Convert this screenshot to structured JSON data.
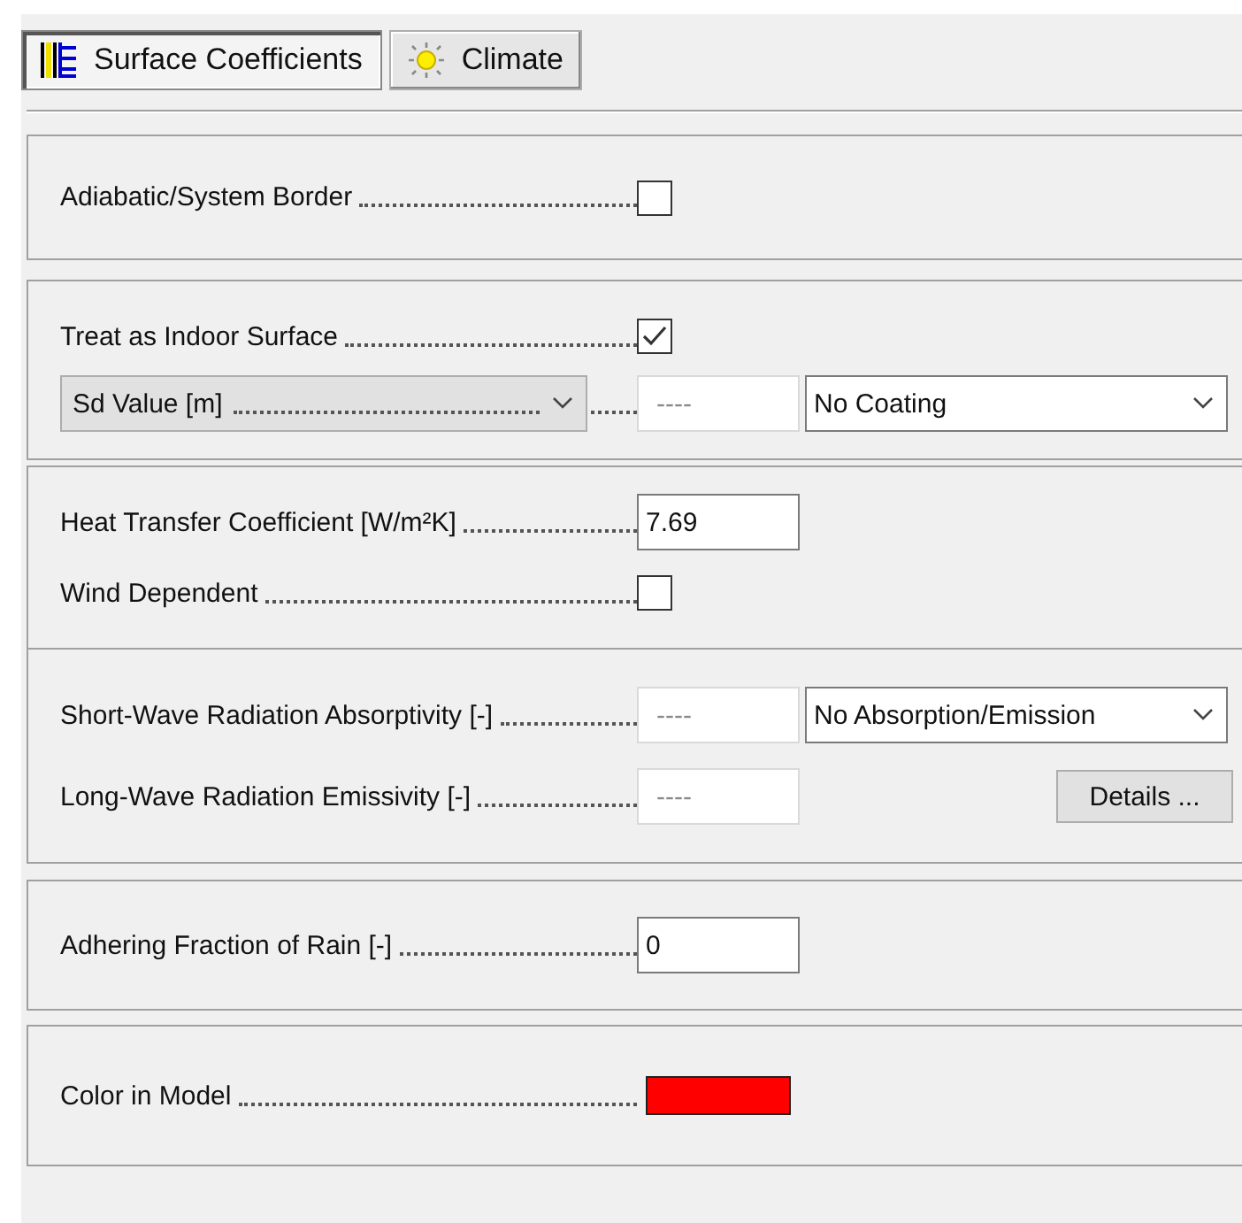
{
  "tabs": [
    {
      "label": "Surface Coefficients",
      "selected": true
    },
    {
      "label": "Climate",
      "selected": false
    }
  ],
  "groups": [
    {
      "rows": [
        {
          "kind": "checkbox",
          "label": "Adiabatic/System Border",
          "checked": false
        }
      ]
    },
    {
      "rows": [
        {
          "kind": "checkbox",
          "label": "Treat as Indoor Surface",
          "checked": true
        },
        {
          "kind": "select-input-select",
          "select": "Sd Value [m]",
          "value": "----",
          "disabled": true,
          "dropdown": "No Coating"
        }
      ]
    },
    {
      "rows": [
        {
          "kind": "input",
          "label": "Heat Transfer Coefficient [W/m²K]",
          "value": "7.69",
          "disabled": false
        },
        {
          "kind": "checkbox",
          "label": "Wind Dependent",
          "checked": false
        }
      ]
    },
    {
      "rows": [
        {
          "kind": "input-select",
          "label": "Short-Wave Radiation Absorptivity [-]",
          "value": "----",
          "disabled": true,
          "dropdown": "No Absorption/Emission"
        },
        {
          "kind": "input-button",
          "label": "Long-Wave Radiation Emissivity [-]",
          "value": "----",
          "disabled": true,
          "button": "Details ..."
        }
      ]
    },
    {
      "rows": [
        {
          "kind": "input",
          "label": "Adhering Fraction of Rain [-]",
          "value": "0",
          "disabled": false
        }
      ]
    },
    {
      "rows": [
        {
          "kind": "color",
          "label": "Color in Model",
          "color": "#ff0000"
        }
      ]
    }
  ]
}
